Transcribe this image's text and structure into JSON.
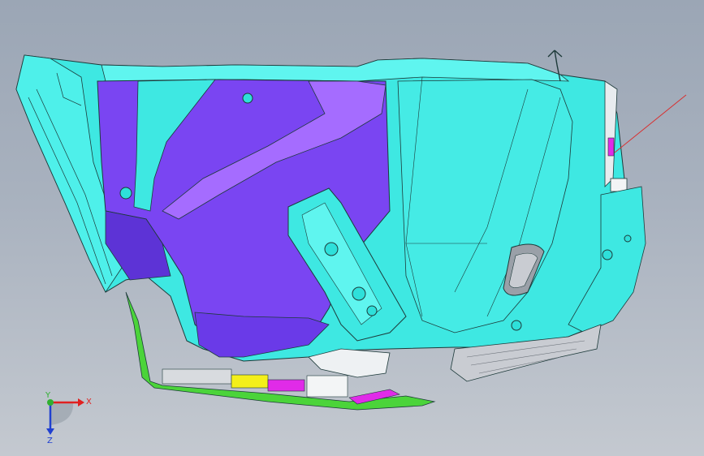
{
  "viewport": {
    "background_top": "#9ba6b5",
    "background_bottom": "#c4c9d0"
  },
  "model": {
    "colors": {
      "cyan_panel": "#3ee8e2",
      "cyan_light": "#5ff5ef",
      "cyan_dark": "#22c5c0",
      "purple_panel": "#7a45f2",
      "purple_light": "#a56cff",
      "magenta": "#e02be8",
      "green_strip": "#4bd43a",
      "yellow_block": "#f4ef1a",
      "gray_part": "#c9ccd2",
      "edge_line": "#1d3a3a"
    }
  },
  "triad": {
    "x_label": "X",
    "y_label": "Y",
    "z_label": "Z",
    "x_color": "#e02020",
    "y_color": "#30b030",
    "z_color": "#2040d0"
  }
}
